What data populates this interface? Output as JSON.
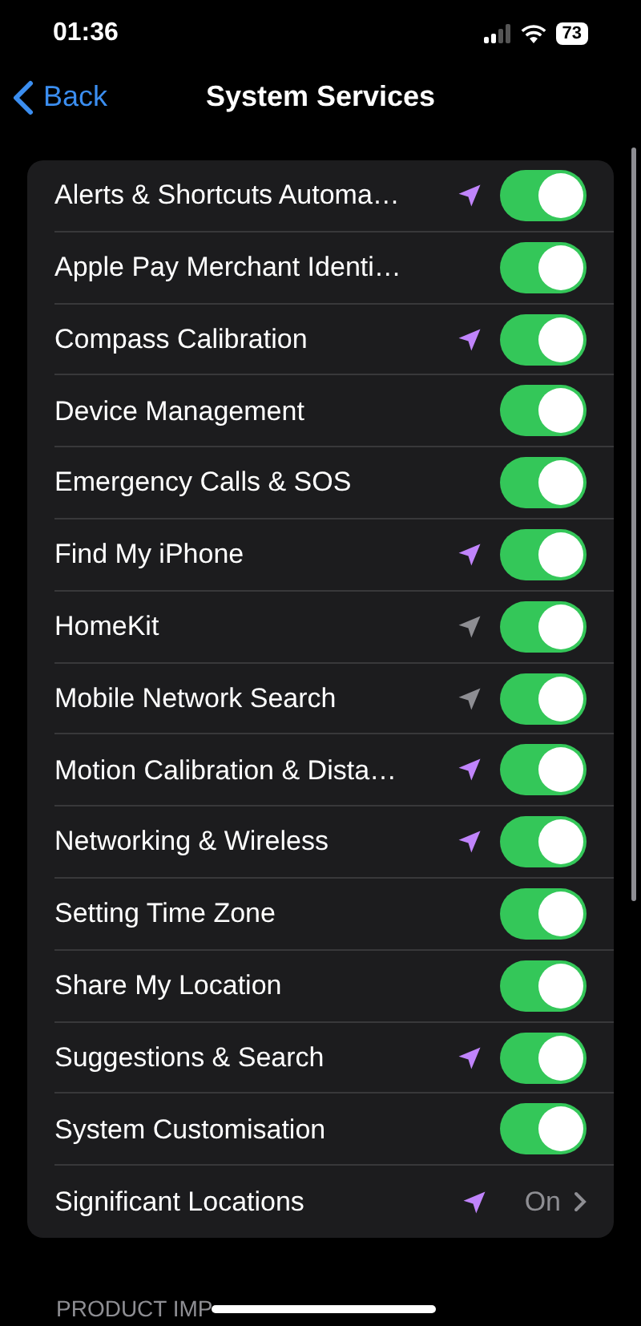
{
  "status_bar": {
    "time": "01:36",
    "battery": "73"
  },
  "nav": {
    "back": "Back",
    "title": "System Services"
  },
  "rows": [
    {
      "kind": "toggle",
      "label": "Alerts & Shortcuts Automa…",
      "color": "#c084fc",
      "on": true
    },
    {
      "kind": "toggle",
      "label": "Apple Pay Merchant Identi…",
      "on": true
    },
    {
      "kind": "toggle",
      "label": "Compass Calibration",
      "color": "#c084fc",
      "on": true
    },
    {
      "kind": "toggle",
      "label": "Device Management",
      "on": true
    },
    {
      "kind": "toggle",
      "label": "Emergency Calls & SOS",
      "on": true
    },
    {
      "kind": "toggle",
      "label": "Find My iPhone",
      "color": "#c084fc",
      "on": true
    },
    {
      "kind": "toggle",
      "label": "HomeKit",
      "color": "#8e8e93",
      "on": true
    },
    {
      "kind": "toggle",
      "label": "Mobile Network Search",
      "color": "#8e8e93",
      "on": true
    },
    {
      "kind": "toggle",
      "label": "Motion Calibration & Dista…",
      "color": "#c084fc",
      "on": true
    },
    {
      "kind": "toggle",
      "label": "Networking & Wireless",
      "color": "#c084fc",
      "on": true
    },
    {
      "kind": "toggle",
      "label": "Setting Time Zone",
      "on": true
    },
    {
      "kind": "toggle",
      "label": "Share My Location",
      "on": true
    },
    {
      "kind": "toggle",
      "label": "Suggestions & Search",
      "color": "#c084fc",
      "on": true
    },
    {
      "kind": "toggle",
      "label": "System Customisation",
      "on": true
    },
    {
      "kind": "link",
      "label": "Significant Locations",
      "color": "#c084fc",
      "value": "On"
    }
  ],
  "section_header": "PRODUCT IMP"
}
